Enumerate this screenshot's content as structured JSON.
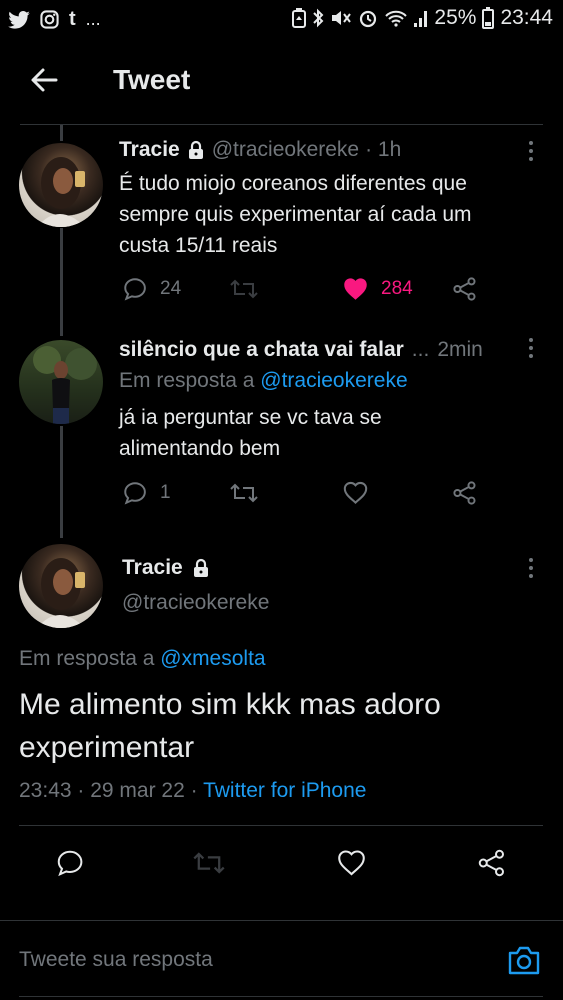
{
  "status_bar": {
    "left_icons": [
      "twitter-icon",
      "instagram-icon",
      "tumblr-icon"
    ],
    "more": "...",
    "battery": "25%",
    "time": "23:44"
  },
  "header": {
    "title": "Tweet"
  },
  "tweet1": {
    "name": "Tracie",
    "handle": "@tracieokereke",
    "time": "· 1h",
    "text_lines": [
      "É tudo miojo coreanos diferentes que",
      "sempre quis experimentar aí cada um",
      "custa 15/11 reais"
    ],
    "replies": "24",
    "likes": "284"
  },
  "tweet2": {
    "name": "silêncio que a chata vai falar",
    "dots": "...",
    "time": "2min",
    "reply_prefix": "Em resposta a",
    "reply_to": "@tracieokereke",
    "text_lines": [
      "já ia perguntar se vc tava se",
      "alimentando bem"
    ],
    "replies": "1"
  },
  "main_tweet": {
    "name": "Tracie",
    "handle": "@tracieokereke",
    "reply_prefix": "Em resposta a",
    "reply_to": "@xmesolta",
    "text_lines": [
      "Me alimento sim kkk mas adoro",
      "experimentar"
    ],
    "timestamp": "23:43 · 29 mar 22 ·",
    "source": "Twitter for iPhone"
  },
  "reply_box": {
    "placeholder": "Tweete sua resposta"
  },
  "colors": {
    "background": "#000000",
    "accent": "#1d9bf0",
    "like": "#f91880",
    "text_secondary": "#71767b"
  }
}
